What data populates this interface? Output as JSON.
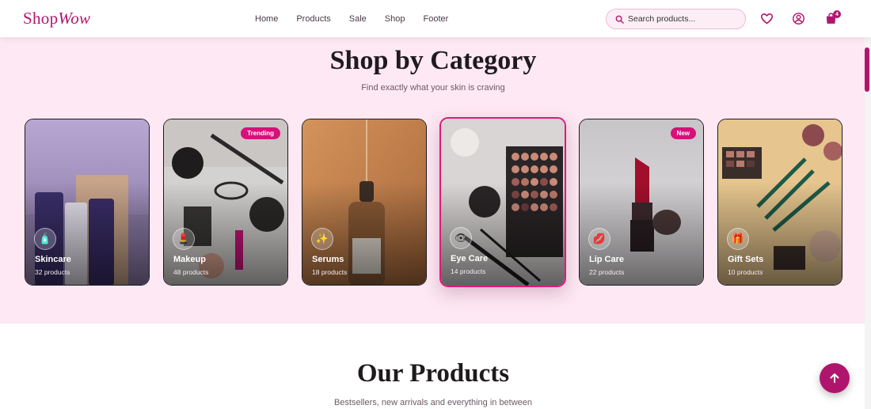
{
  "header": {
    "logo_plain": "Shop",
    "logo_italic": "Wow",
    "nav": [
      "Home",
      "Products",
      "Sale",
      "Shop",
      "Footer"
    ],
    "search_placeholder": "Search products...",
    "cart_count": "4"
  },
  "categories": {
    "title": "Shop by Category",
    "subtitle": "Find exactly what your skin is craving",
    "items": [
      {
        "name": "Skincare",
        "count": "32 products",
        "tag": "",
        "icon": "lotion-bottle-icon"
      },
      {
        "name": "Makeup",
        "count": "48 products",
        "tag": "Trending",
        "icon": "lipstick-icon"
      },
      {
        "name": "Serums",
        "count": "18 products",
        "tag": "",
        "icon": "sparkles-icon"
      },
      {
        "name": "Eye Care",
        "count": "14 products",
        "tag": "",
        "icon": "eye-icon"
      },
      {
        "name": "Lip Care",
        "count": "22 products",
        "tag": "New",
        "icon": "lips-icon"
      },
      {
        "name": "Gift Sets",
        "count": "10 products",
        "tag": "",
        "icon": "gift-icon"
      }
    ]
  },
  "products": {
    "title": "Our Products",
    "subtitle": "Bestsellers, new arrivals and everything in between"
  },
  "colors": {
    "brand": "#b0156e",
    "accent": "#e0197d",
    "section_bg": "#fde8f3"
  }
}
